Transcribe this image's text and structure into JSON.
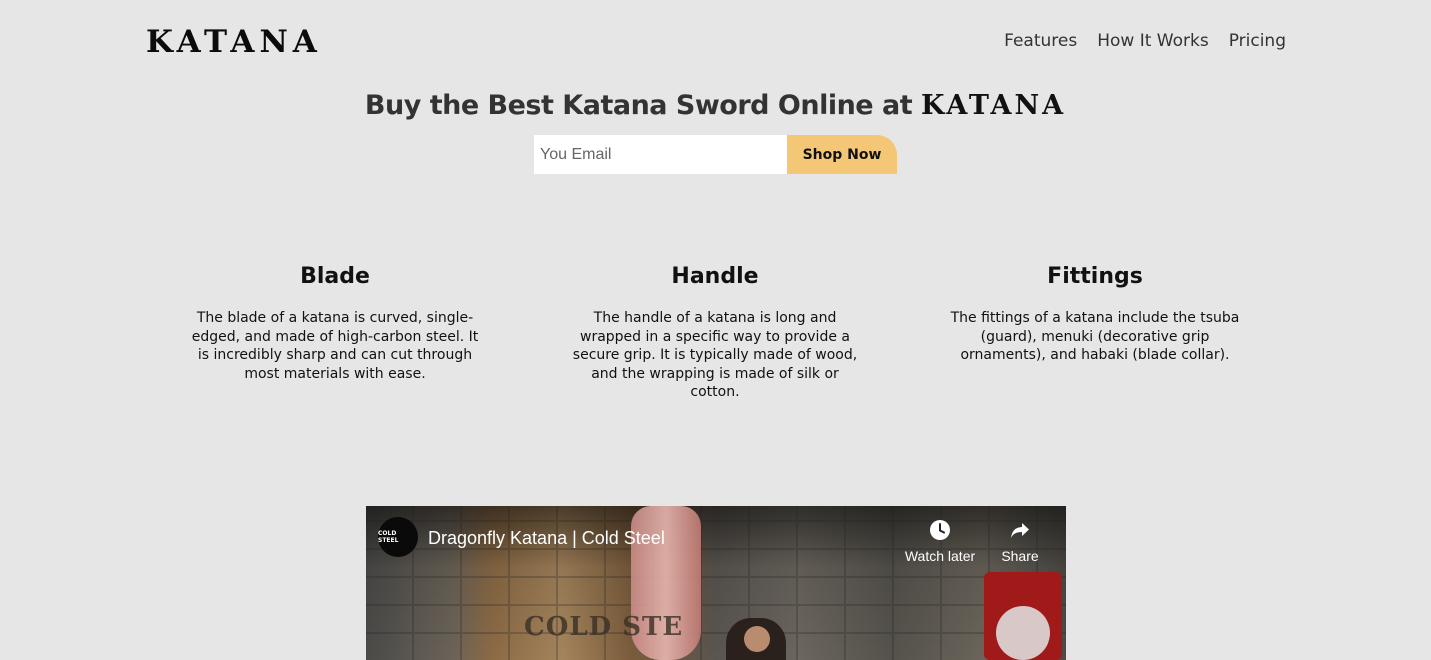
{
  "header": {
    "logo": "KATANA",
    "nav": [
      "Features",
      "How It Works",
      "Pricing"
    ]
  },
  "hero": {
    "title_prefix": "Buy the Best Katana Sword Online at ",
    "title_brand": "KATANA",
    "email_placeholder": "You Email",
    "cta_label": "Shop Now"
  },
  "features": [
    {
      "title": "Blade",
      "text": "The blade of a katana is curved, single-edged, and made of high-carbon steel. It is incredibly sharp and can cut through most materials with ease."
    },
    {
      "title": "Handle",
      "text": "The handle of a katana is long and wrapped in a specific way to provide a secure grip. It is typically made of wood, and the wrapping is made of silk or cotton."
    },
    {
      "title": "Fittings",
      "text": "The fittings of a katana include the tsuba (guard), menuki (decorative grip ornaments), and habaki (blade collar)."
    }
  ],
  "video": {
    "title": "Dragonfly Katana | Cold Steel",
    "channel_badge": "COLD STEEL",
    "scene_text": "COLD STE",
    "watch_later_label": "Watch later",
    "share_label": "Share"
  },
  "colors": {
    "background": "#e6e6e6",
    "cta": "#f3c775",
    "heading": "#333333"
  }
}
